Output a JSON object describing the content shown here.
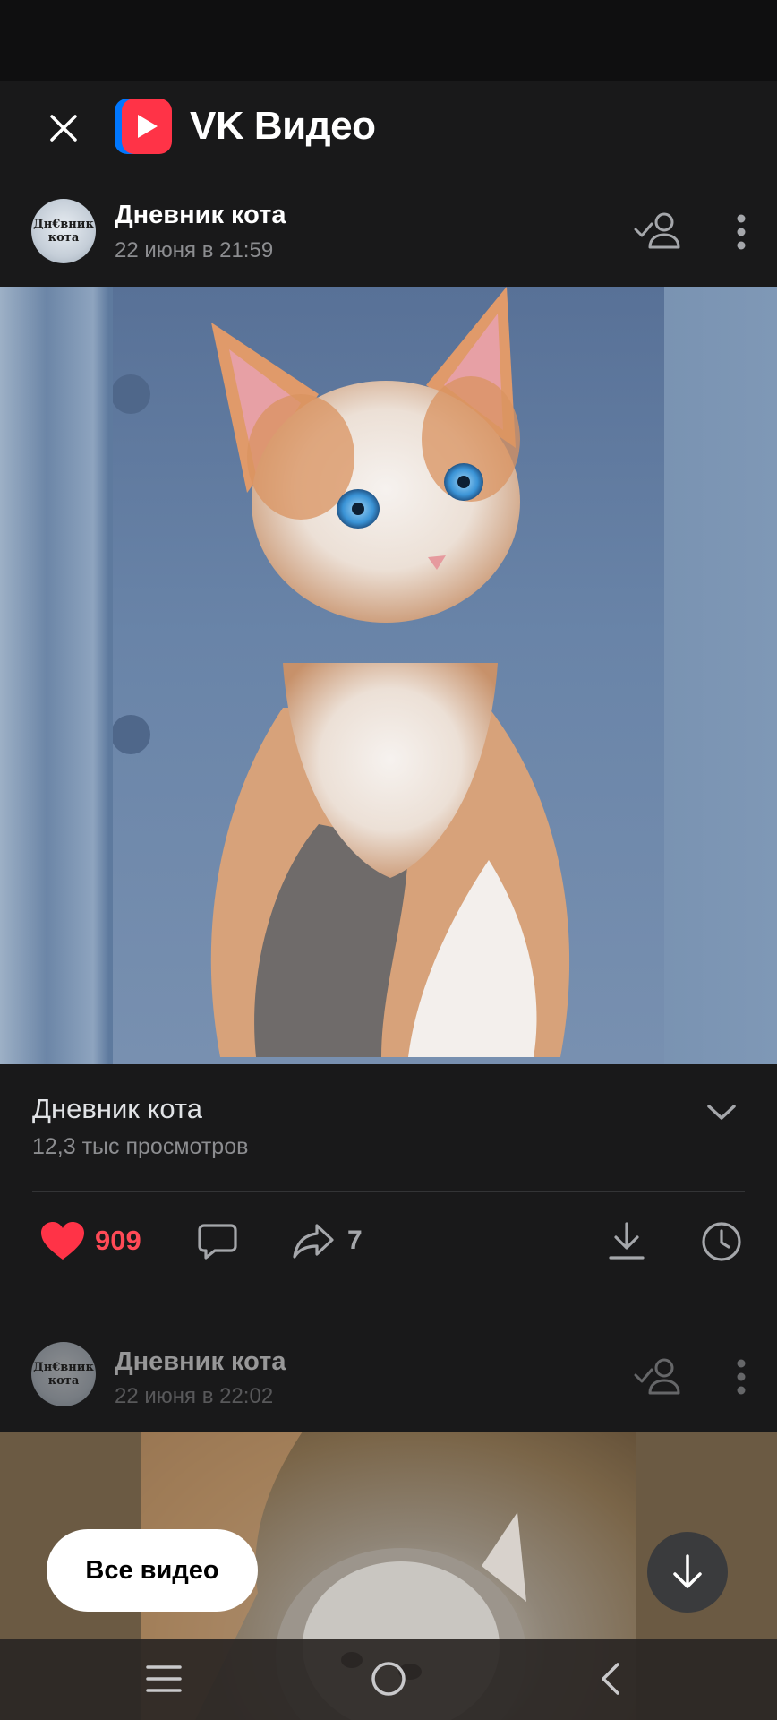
{
  "app": {
    "brand_name": "VK Видео",
    "accent": "#0077ff",
    "logo_color": "#ff3347"
  },
  "post": {
    "author": "Дневник кота",
    "date": "22 июня в 21:59",
    "avatar_text": "Дн€вник кота",
    "video_title": "Дневник кота",
    "views": "12,3 тыс просмотров",
    "likes": "909",
    "shares": "7"
  },
  "next_post": {
    "author": "Дневник кота",
    "date": "22 июня в 22:02",
    "avatar_text": "Дн€вник кота"
  },
  "buttons": {
    "all_videos": "Все видео"
  },
  "icons": {
    "close": "close-icon",
    "subscribe": "add-friend-icon",
    "more": "more-vertical-icon",
    "expand": "chevron-down-icon",
    "like": "heart-icon",
    "comment": "comment-icon",
    "share": "share-icon",
    "download": "download-icon",
    "watch_later": "clock-icon",
    "scroll_down": "arrow-down-icon",
    "nav_menu": "menu-icon",
    "nav_home": "home-icon",
    "nav_back": "back-icon"
  }
}
